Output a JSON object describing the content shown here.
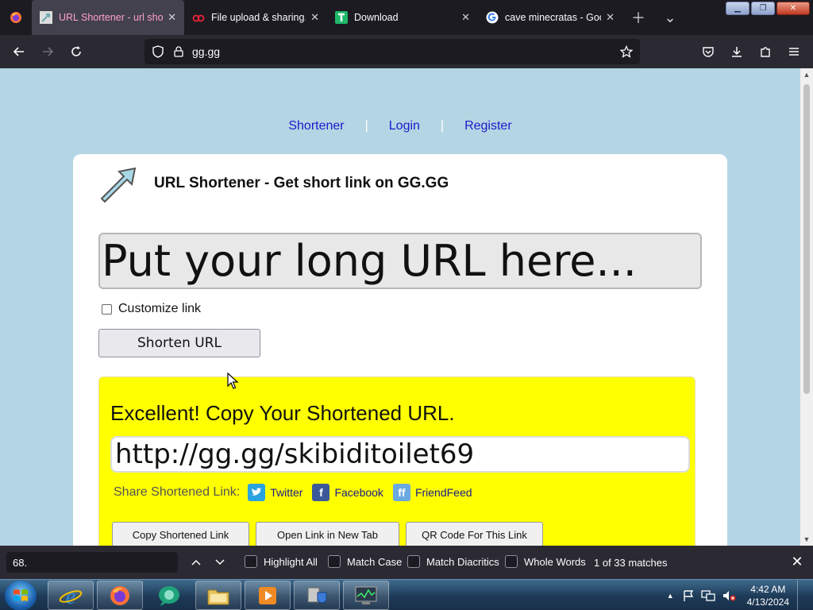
{
  "tabs": [
    {
      "title": "URL Shortener - url short",
      "active": true
    },
    {
      "title": "File upload & sharing. Se",
      "active": false
    },
    {
      "title": "Download",
      "active": false
    },
    {
      "title": "cave minecratas - Google",
      "active": false
    }
  ],
  "address": {
    "url": "gg.gg"
  },
  "page": {
    "nav": {
      "shortener": "Shortener",
      "login": "Login",
      "register": "Register",
      "sep": "|"
    },
    "title": "URL Shortener - Get short link on GG.GG",
    "long_url_placeholder": "Put your long URL here...",
    "customize_label": "Customize link",
    "shorten_button": "Shorten URL",
    "result": {
      "heading": "Excellent! Copy Your Shortened URL.",
      "short_url": "http://gg.gg/skibiditoilet69",
      "share_label": "Share Shortened Link:",
      "share": {
        "twitter": "Twitter",
        "facebook": "Facebook",
        "friendfeed": "FriendFeed"
      },
      "actions": {
        "copy": "Copy Shortened Link",
        "open": "Open Link in New Tab",
        "qr": "QR Code For This Link"
      }
    }
  },
  "findbar": {
    "query": "68.",
    "highlight_all": "Highlight All",
    "match_case": "Match Case",
    "match_diacritics": "Match Diacritics",
    "whole_words": "Whole Words",
    "matches": "1 of 33 matches"
  },
  "taskbar": {
    "time": "4:42 AM",
    "date": "4/13/2024"
  },
  "colors": {
    "page_bg": "#b4d5e3",
    "result_bg": "#ffff00",
    "link": "#1a1acc",
    "active_tab_title": "#ff9fd0"
  }
}
